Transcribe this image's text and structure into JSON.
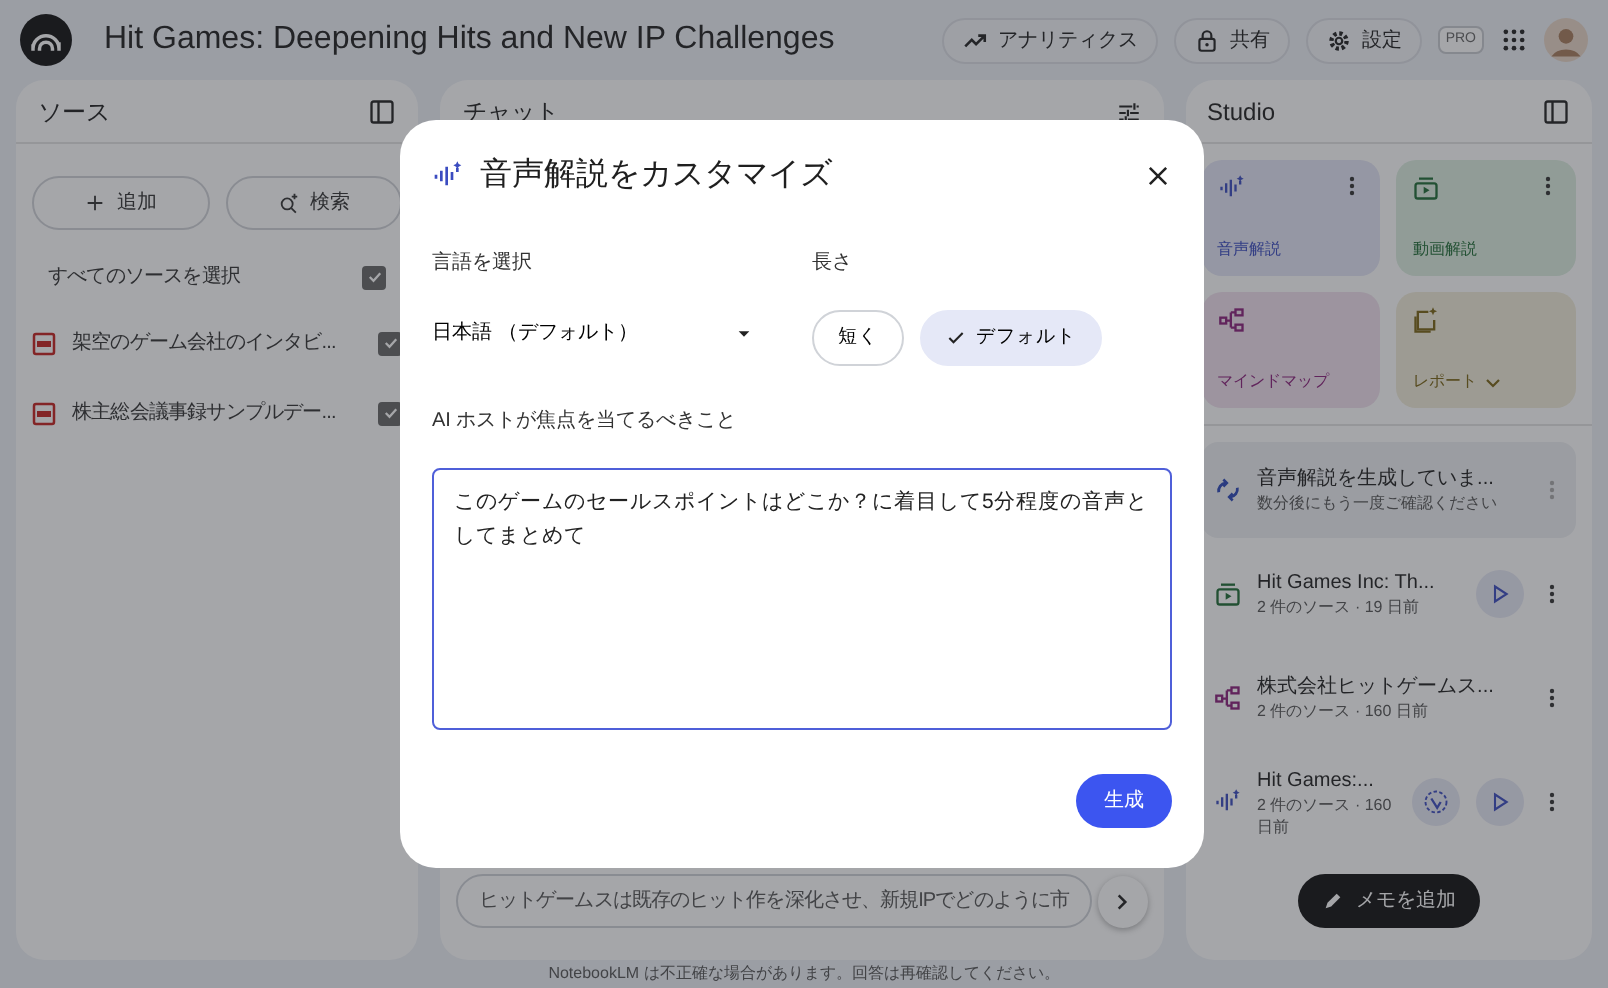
{
  "app_bar": {
    "title": "Hit Games: Deepening Hits and New IP Challenges",
    "actions": [
      {
        "kind": "analytics",
        "label": "アナリティクス"
      },
      {
        "kind": "share",
        "label": "共有"
      },
      {
        "kind": "settings",
        "label": "設定"
      }
    ],
    "plan_badge": "PRO"
  },
  "sources": {
    "title": "ソース",
    "buttons": [
      {
        "kind": "add",
        "label": "追加"
      },
      {
        "kind": "search",
        "label": "検索"
      }
    ],
    "select_all": {
      "label": "すべてのソースを選択",
      "checked": true
    },
    "items": [
      {
        "name": "架空のゲーム会社のインタビ...",
        "checked": true
      },
      {
        "name": "株主総会議事録サンプルデー...",
        "checked": true
      }
    ]
  },
  "chat": {
    "title": "チャット",
    "input_value": "ヒットゲームスは既存のヒット作を深化させ、新規IPでどのように市"
  },
  "studio": {
    "title": "Studio",
    "tiles": [
      {
        "kind": "audio",
        "label": "音声解説",
        "more": true
      },
      {
        "kind": "video",
        "label": "動画解説",
        "more": true
      },
      {
        "kind": "mindmap",
        "label": "マインドマップ",
        "more": false
      },
      {
        "kind": "report",
        "label": "レポート",
        "more": false
      }
    ],
    "items": [
      {
        "kind": "generating",
        "title": "音声解説を生成していま...",
        "subtitle": "数分後にもう一度ご確認ください"
      },
      {
        "kind": "video",
        "title": "Hit Games Inc: Th...",
        "subtitle": "2 件のソース · 19 日前",
        "interactive": false,
        "play": true
      },
      {
        "kind": "mindmap",
        "title": "株式会社ヒットゲームス...",
        "subtitle": "2 件のソース · 160 日前",
        "interactive": false,
        "play": false
      },
      {
        "kind": "audio",
        "title": "Hit Games:...",
        "subtitle": "2 件のソース · 160 日前",
        "interactive": true,
        "play": true
      }
    ],
    "add_note": "メモを追加"
  },
  "footer": "NotebookLM は不正確な場合があります。回答は再確認してください。",
  "dialog": {
    "title": "音声解説をカスタマイズ",
    "language_label": "言語を選択",
    "language_value": "日本語 （デフォルト）",
    "length_label": "長さ",
    "length_options": [
      {
        "label": "短く",
        "selected": false
      },
      {
        "label": "デフォルト",
        "selected": true
      }
    ],
    "focus_label": "AI ホストが焦点を当てるべきこと",
    "focus_value": "このゲームのセールスポイントはどこか？に着目して5分程度の音声としてまとめて",
    "submit": "生成"
  }
}
